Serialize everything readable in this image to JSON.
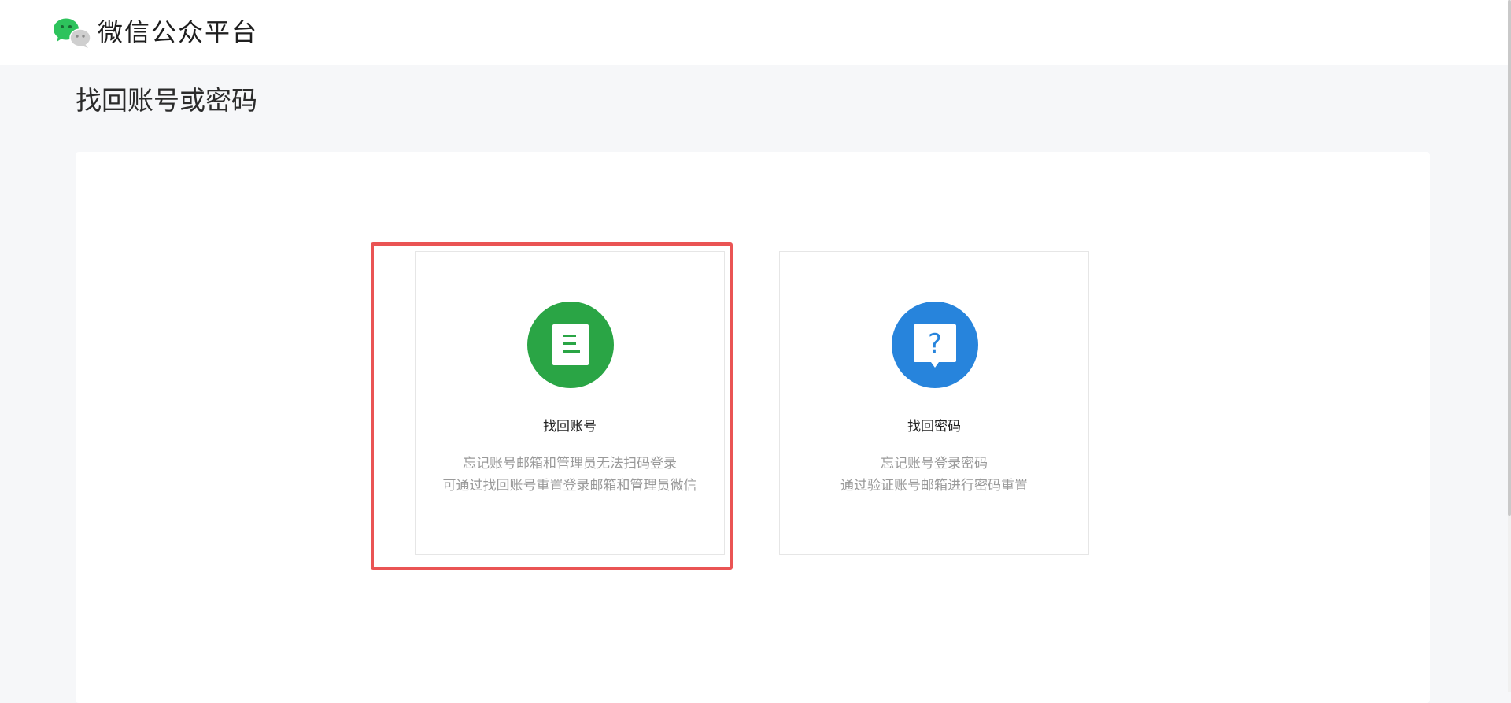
{
  "header": {
    "brand_name": "微信公众平台",
    "logo_icon": "wechat-logo-icon"
  },
  "page": {
    "title": "找回账号或密码"
  },
  "options": [
    {
      "title": "找回账号",
      "description_line1": "忘记账号邮箱和管理员无法扫码登录",
      "description_line2": "可通过找回账号重置登录邮箱和管理员微信",
      "icon": "document-icon",
      "icon_color": "#2aa545",
      "highlighted": true
    },
    {
      "title": "找回密码",
      "description_line1": "忘记账号登录密码",
      "description_line2": "通过验证账号邮箱进行密码重置",
      "icon": "question-bubble-icon",
      "icon_color": "#2784dc",
      "highlighted": false
    }
  ],
  "colors": {
    "highlight_border": "#ea5454",
    "page_background": "#f6f7f9"
  }
}
